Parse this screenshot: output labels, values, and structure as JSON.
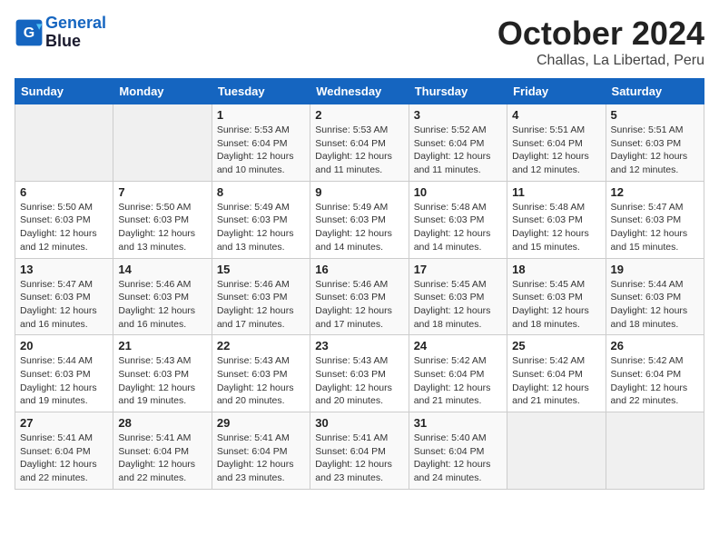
{
  "logo": {
    "line1": "General",
    "line2": "Blue"
  },
  "title": "October 2024",
  "location": "Challas, La Libertad, Peru",
  "weekdays": [
    "Sunday",
    "Monday",
    "Tuesday",
    "Wednesday",
    "Thursday",
    "Friday",
    "Saturday"
  ],
  "weeks": [
    [
      {
        "day": "",
        "info": ""
      },
      {
        "day": "",
        "info": ""
      },
      {
        "day": "1",
        "info": "Sunrise: 5:53 AM\nSunset: 6:04 PM\nDaylight: 12 hours\nand 10 minutes."
      },
      {
        "day": "2",
        "info": "Sunrise: 5:53 AM\nSunset: 6:04 PM\nDaylight: 12 hours\nand 11 minutes."
      },
      {
        "day": "3",
        "info": "Sunrise: 5:52 AM\nSunset: 6:04 PM\nDaylight: 12 hours\nand 11 minutes."
      },
      {
        "day": "4",
        "info": "Sunrise: 5:51 AM\nSunset: 6:04 PM\nDaylight: 12 hours\nand 12 minutes."
      },
      {
        "day": "5",
        "info": "Sunrise: 5:51 AM\nSunset: 6:03 PM\nDaylight: 12 hours\nand 12 minutes."
      }
    ],
    [
      {
        "day": "6",
        "info": "Sunrise: 5:50 AM\nSunset: 6:03 PM\nDaylight: 12 hours\nand 12 minutes."
      },
      {
        "day": "7",
        "info": "Sunrise: 5:50 AM\nSunset: 6:03 PM\nDaylight: 12 hours\nand 13 minutes."
      },
      {
        "day": "8",
        "info": "Sunrise: 5:49 AM\nSunset: 6:03 PM\nDaylight: 12 hours\nand 13 minutes."
      },
      {
        "day": "9",
        "info": "Sunrise: 5:49 AM\nSunset: 6:03 PM\nDaylight: 12 hours\nand 14 minutes."
      },
      {
        "day": "10",
        "info": "Sunrise: 5:48 AM\nSunset: 6:03 PM\nDaylight: 12 hours\nand 14 minutes."
      },
      {
        "day": "11",
        "info": "Sunrise: 5:48 AM\nSunset: 6:03 PM\nDaylight: 12 hours\nand 15 minutes."
      },
      {
        "day": "12",
        "info": "Sunrise: 5:47 AM\nSunset: 6:03 PM\nDaylight: 12 hours\nand 15 minutes."
      }
    ],
    [
      {
        "day": "13",
        "info": "Sunrise: 5:47 AM\nSunset: 6:03 PM\nDaylight: 12 hours\nand 16 minutes."
      },
      {
        "day": "14",
        "info": "Sunrise: 5:46 AM\nSunset: 6:03 PM\nDaylight: 12 hours\nand 16 minutes."
      },
      {
        "day": "15",
        "info": "Sunrise: 5:46 AM\nSunset: 6:03 PM\nDaylight: 12 hours\nand 17 minutes."
      },
      {
        "day": "16",
        "info": "Sunrise: 5:46 AM\nSunset: 6:03 PM\nDaylight: 12 hours\nand 17 minutes."
      },
      {
        "day": "17",
        "info": "Sunrise: 5:45 AM\nSunset: 6:03 PM\nDaylight: 12 hours\nand 18 minutes."
      },
      {
        "day": "18",
        "info": "Sunrise: 5:45 AM\nSunset: 6:03 PM\nDaylight: 12 hours\nand 18 minutes."
      },
      {
        "day": "19",
        "info": "Sunrise: 5:44 AM\nSunset: 6:03 PM\nDaylight: 12 hours\nand 18 minutes."
      }
    ],
    [
      {
        "day": "20",
        "info": "Sunrise: 5:44 AM\nSunset: 6:03 PM\nDaylight: 12 hours\nand 19 minutes."
      },
      {
        "day": "21",
        "info": "Sunrise: 5:43 AM\nSunset: 6:03 PM\nDaylight: 12 hours\nand 19 minutes."
      },
      {
        "day": "22",
        "info": "Sunrise: 5:43 AM\nSunset: 6:03 PM\nDaylight: 12 hours\nand 20 minutes."
      },
      {
        "day": "23",
        "info": "Sunrise: 5:43 AM\nSunset: 6:03 PM\nDaylight: 12 hours\nand 20 minutes."
      },
      {
        "day": "24",
        "info": "Sunrise: 5:42 AM\nSunset: 6:04 PM\nDaylight: 12 hours\nand 21 minutes."
      },
      {
        "day": "25",
        "info": "Sunrise: 5:42 AM\nSunset: 6:04 PM\nDaylight: 12 hours\nand 21 minutes."
      },
      {
        "day": "26",
        "info": "Sunrise: 5:42 AM\nSunset: 6:04 PM\nDaylight: 12 hours\nand 22 minutes."
      }
    ],
    [
      {
        "day": "27",
        "info": "Sunrise: 5:41 AM\nSunset: 6:04 PM\nDaylight: 12 hours\nand 22 minutes."
      },
      {
        "day": "28",
        "info": "Sunrise: 5:41 AM\nSunset: 6:04 PM\nDaylight: 12 hours\nand 22 minutes."
      },
      {
        "day": "29",
        "info": "Sunrise: 5:41 AM\nSunset: 6:04 PM\nDaylight: 12 hours\nand 23 minutes."
      },
      {
        "day": "30",
        "info": "Sunrise: 5:41 AM\nSunset: 6:04 PM\nDaylight: 12 hours\nand 23 minutes."
      },
      {
        "day": "31",
        "info": "Sunrise: 5:40 AM\nSunset: 6:04 PM\nDaylight: 12 hours\nand 24 minutes."
      },
      {
        "day": "",
        "info": ""
      },
      {
        "day": "",
        "info": ""
      }
    ]
  ]
}
